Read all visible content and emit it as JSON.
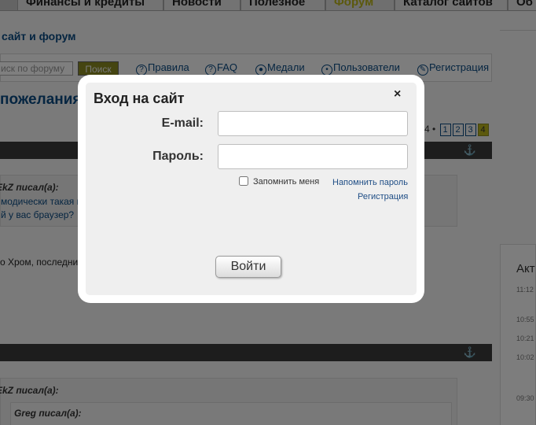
{
  "background": {
    "tabs": [
      "Финансы и кредиты",
      "Новости",
      "Полезное",
      "Форум",
      "Каталог сайтов",
      "Об"
    ],
    "active_tab": "Форум",
    "page_title": "сайт и форум",
    "search_placeholder": "иск по форуму",
    "search_button": "Поиск",
    "toolbar_links": [
      "Правила",
      "FAQ",
      "Медали",
      "Пользователи",
      "Регистрация"
    ],
    "topic_title": "пожелания",
    "pager": {
      "prefix": "4 •",
      "pages": [
        "1",
        "2",
        "3",
        "4"
      ],
      "current": "4"
    },
    "post1": {
      "quote_author": "EkZ писал(а):",
      "quote_lines": [
        "модически такая п",
        "й у вас браузер?"
      ],
      "text": "о Хром, последни"
    },
    "post2": {
      "quote_author": "EkZ писал(а):",
      "nested_author": "Greg писал(а):"
    },
    "side": {
      "title": "Акт",
      "times": [
        "11:12",
        "10:55",
        "10:21",
        "10:02",
        "09:30"
      ]
    }
  },
  "modal": {
    "title": "Вход на сайт",
    "close_symbol": "×",
    "email_label": "E-mail:",
    "email_value": "",
    "password_label": "Пароль:",
    "password_value": "",
    "remember_label": "Запомнить меня",
    "remember_checked": false,
    "remind_password_link": "Напомнить пароль",
    "register_link": "Регистрация",
    "login_button": "Войти"
  }
}
